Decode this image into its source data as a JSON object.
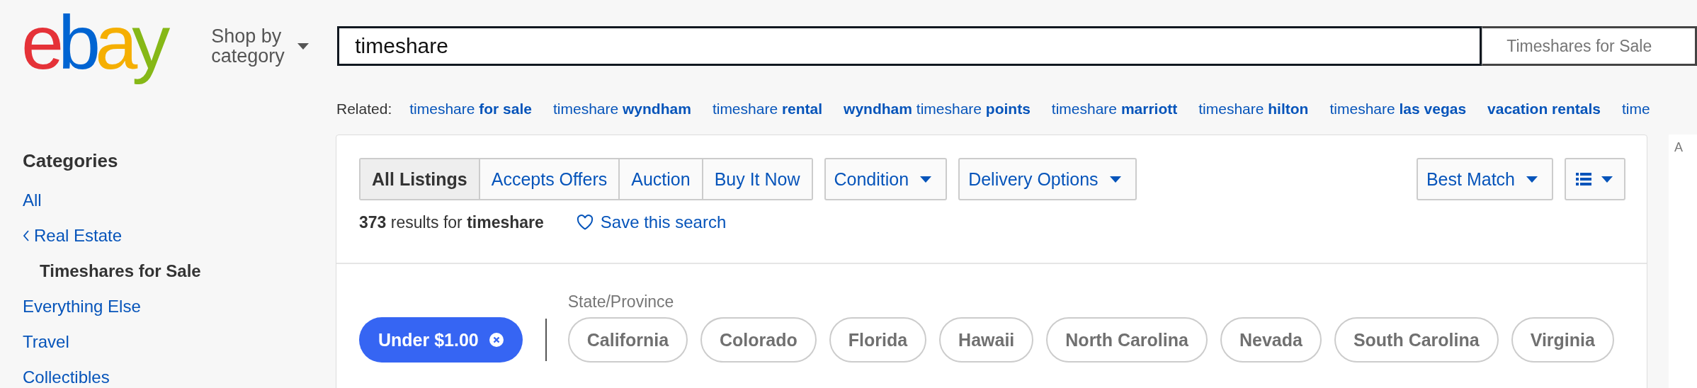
{
  "header": {
    "logo": "ebay",
    "shop_by_category": "Shop by category",
    "search": {
      "value": "timeshare"
    },
    "category_select": "Timeshares for Sale"
  },
  "related": {
    "label": "Related:",
    "links": [
      {
        "text": "timeshare **for sale**"
      },
      {
        "text": "timeshare **wyndham**"
      },
      {
        "text": "timeshare **rental**"
      },
      {
        "text": "**wyndham** timeshare **points**"
      },
      {
        "text": "timeshare **marriott**"
      },
      {
        "text": "timeshare **hilton**"
      },
      {
        "text": "timeshare **las vegas**"
      },
      {
        "text": "**vacation rentals**"
      },
      {
        "text": "time"
      }
    ]
  },
  "sidebar": {
    "title": "Categories",
    "items": [
      {
        "label": "All",
        "kind": "link"
      },
      {
        "label": "Real Estate",
        "kind": "parent"
      },
      {
        "label": "Timeshares for Sale",
        "kind": "current"
      },
      {
        "label": "Everything Else",
        "kind": "link"
      },
      {
        "label": "Travel",
        "kind": "link"
      },
      {
        "label": "Collectibles",
        "kind": "link"
      }
    ]
  },
  "listing_tabs": [
    {
      "label": "All Listings",
      "selected": true
    },
    {
      "label": "Accepts Offers",
      "selected": false
    },
    {
      "label": "Auction",
      "selected": false
    },
    {
      "label": "Buy It Now",
      "selected": false
    }
  ],
  "filters": [
    "Condition",
    "Delivery Options"
  ],
  "sort": "Best Match",
  "results": {
    "text": "**373** results for **timeshare**",
    "save_search": "Save this search"
  },
  "active_filter": "Under $1.00",
  "state_filter": {
    "label": "State/Province",
    "chips": [
      "California",
      "Colorado",
      "Florida",
      "Hawaii",
      "North Carolina",
      "Nevada",
      "South Carolina",
      "Virginia"
    ]
  },
  "ad_label": "A"
}
